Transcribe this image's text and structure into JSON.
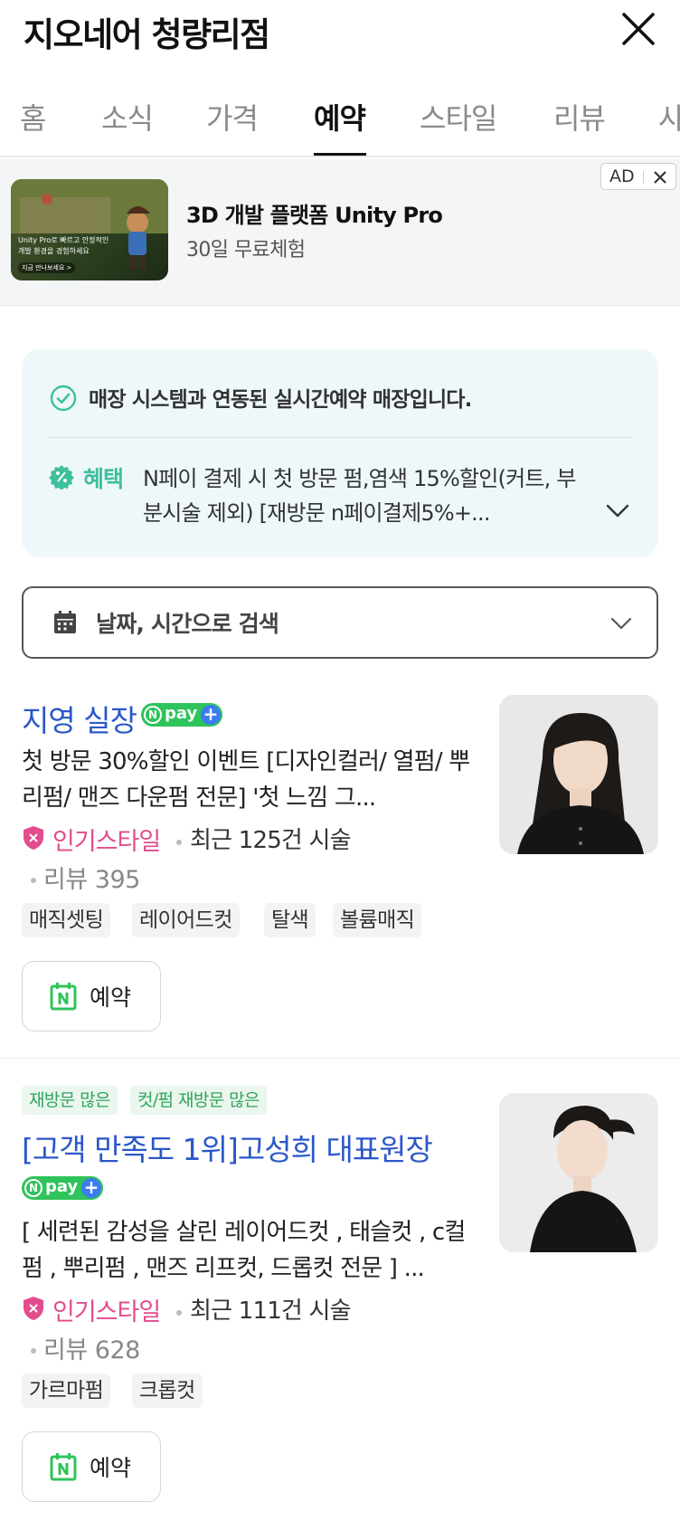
{
  "header": {
    "title": "지오네어 청량리점"
  },
  "tabs": [
    {
      "label": "홈"
    },
    {
      "label": "소식"
    },
    {
      "label": "가격"
    },
    {
      "label": "예약"
    },
    {
      "label": "스타일"
    },
    {
      "label": "리뷰"
    },
    {
      "label": "사"
    }
  ],
  "active_tab": "예약",
  "ad": {
    "badge": "AD",
    "title": "3D 개발 플랫폼 Unity Pro",
    "subtitle": "30일 무료체험",
    "thumb_text_1": "Unity Pro로 빠르고 안정적인",
    "thumb_text_2": "개발 환경을 경험하세요",
    "thumb_cta": "지금 만나보세요 >"
  },
  "info": {
    "realtime": "매장 시스템과 연동된 실시간예약 매장입니다.",
    "benefit_label": "혜택",
    "benefit_text": "N페이 결제 시 첫 방문 펌,염색 15%할인(커트, 부분시술 제외) [재방문 n페이결제5%+..."
  },
  "search": {
    "label": "날짜, 시간으로 검색"
  },
  "staff": [
    {
      "name": "지영 실장",
      "npay": "pay",
      "description": "첫 방문 30%할인 이벤트 [디자인컬러/ 열펌/ 뿌리펌/ 맨즈 다운펌 전문] '첫 느낌 그...",
      "popular": "인기스타일",
      "recent": "최근 125건 시술",
      "review": "리뷰 395",
      "tags": [
        "매직셋팅",
        "레이어드컷",
        "탈색",
        "볼륨매직"
      ],
      "reserve": "예약"
    },
    {
      "badges": [
        "재방문 많은",
        "컷/펌 재방문 많은"
      ],
      "name": "[고객 만족도 1위]고성희 대표원장",
      "npay": "pay",
      "description": "[ 세련된 감성을 살린 레이어드컷 , 태슬컷 , c컬펌 , 뿌리펌 , 맨즈 리프컷, 드롭컷 전문 ] ...",
      "popular": "인기스타일",
      "recent": "최근 111건 시술",
      "review": "리뷰 628",
      "tags": [
        "가르마펌",
        "크롭컷"
      ],
      "reserve": "예약"
    }
  ],
  "colors": {
    "link_blue": "#2b57c9",
    "npay_green": "#2fc35b",
    "popular_pink": "#e34c8c",
    "benefit_mint": "#3fbf9c"
  },
  "icons": [
    "close-icon",
    "check-circle-icon",
    "percent-badge-icon",
    "chevron-down-icon",
    "calendar-icon",
    "shield-icon",
    "naver-calendar-icon"
  ]
}
